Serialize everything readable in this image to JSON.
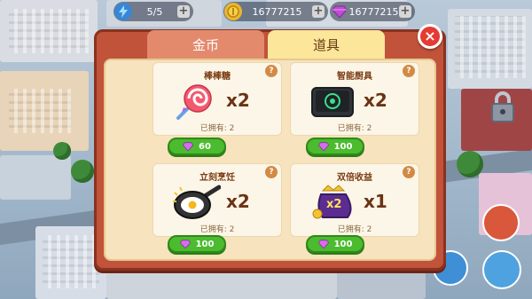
{
  "hud": {
    "energy": "5/5",
    "coins": "16777215",
    "gems": "16777215"
  },
  "tabs": {
    "gold": "金币",
    "items": "道具"
  },
  "close_label": "×",
  "help_glyph": "?",
  "items": [
    {
      "name": "棒棒糖",
      "qty": "x2",
      "owned": "已拥有: 2",
      "price": "60"
    },
    {
      "name": "智能厨具",
      "qty": "x2",
      "owned": "已拥有: 2",
      "price": "100"
    },
    {
      "name": "立刻烹饪",
      "qty": "x2",
      "owned": "已拥有: 2",
      "price": "100"
    },
    {
      "name": "双倍收益",
      "qty": "x1",
      "owned": "已拥有: 2",
      "price": "100"
    }
  ],
  "double_badge": "x2",
  "icons": {
    "energy": "lightning-icon",
    "coin": "coin-icon",
    "gem": "gem-icon",
    "close": "close-icon",
    "lock": "lock-icon"
  },
  "colors": {
    "accent_red": "#c0533a",
    "buy_green": "#4cbb2f",
    "gem_purple": "#c04bd6"
  }
}
